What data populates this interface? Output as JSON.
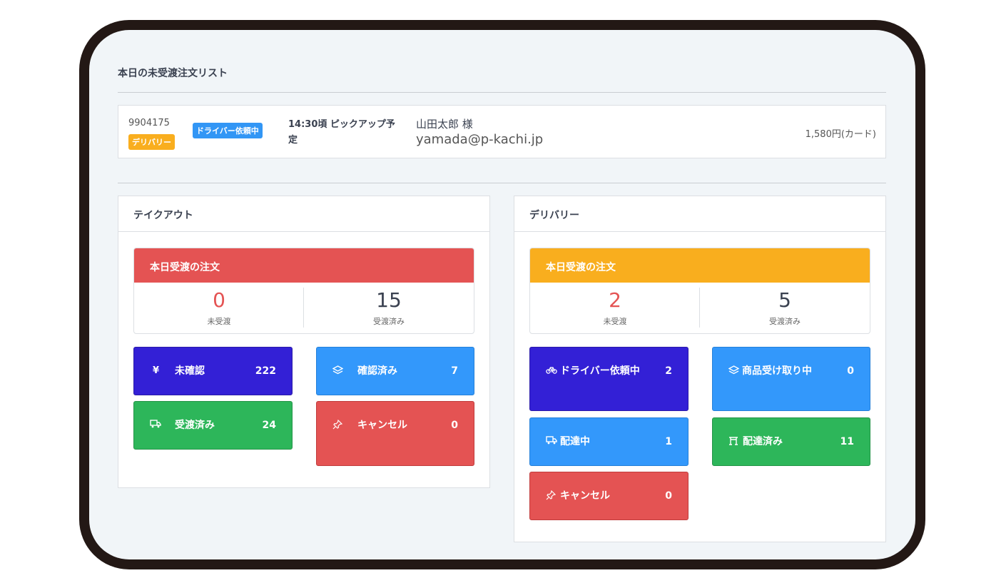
{
  "page": {
    "section_title": "本日の未受渡注文リスト"
  },
  "order": {
    "id": "9904175",
    "type_badge": "デリバリー",
    "status_badge": "ドライバー依頼中",
    "time": "14:30頃 ピックアップ予定",
    "customer_name": "山田太郎 様",
    "email": "yamada@p-kachi.jp",
    "price": "1,580円(カード)"
  },
  "takeout": {
    "title": "テイクアウト",
    "today_title": "本日受渡の注文",
    "pending_value": "0",
    "pending_label": "未受渡",
    "done_value": "15",
    "done_label": "受渡済み",
    "tiles": [
      {
        "icon": "yen-icon",
        "label": "未確認",
        "count": "222",
        "color": "#3320d6"
      },
      {
        "icon": "layers-icon",
        "label": "確認済み",
        "count": "7",
        "color": "#3398fb"
      },
      {
        "icon": "truck-icon",
        "label": "受渡済み",
        "count": "24",
        "color": "#2db65a"
      },
      {
        "icon": "pin-icon",
        "label": "キャンセル",
        "count": "0",
        "color": "#e45353"
      }
    ]
  },
  "delivery": {
    "title": "デリバリー",
    "today_title": "本日受渡の注文",
    "pending_value": "2",
    "pending_label": "未受渡",
    "done_value": "5",
    "done_label": "受渡済み",
    "tiles": [
      {
        "icon": "bicycle-icon",
        "label": "ドライバー依頼中",
        "count": "2",
        "color": "#3320d6"
      },
      {
        "icon": "layers-icon",
        "label": "商品受け取り中",
        "count": "0",
        "color": "#3398fb"
      },
      {
        "icon": "truck-icon",
        "label": "配達中",
        "count": "1",
        "color": "#3398fb"
      },
      {
        "icon": "gate-icon",
        "label": "配達済み",
        "count": "11",
        "color": "#2db65a"
      },
      {
        "icon": "pin-icon",
        "label": "キャンセル",
        "count": "0",
        "color": "#e45353"
      }
    ]
  },
  "colors": {
    "takeout_header": "#e45353",
    "delivery_header": "#f9ae1e",
    "pending_takeout": "#e45353",
    "pending_delivery": "#e45353",
    "badge_yellow": "#f9ae1e",
    "badge_blue": "#3296f5"
  }
}
